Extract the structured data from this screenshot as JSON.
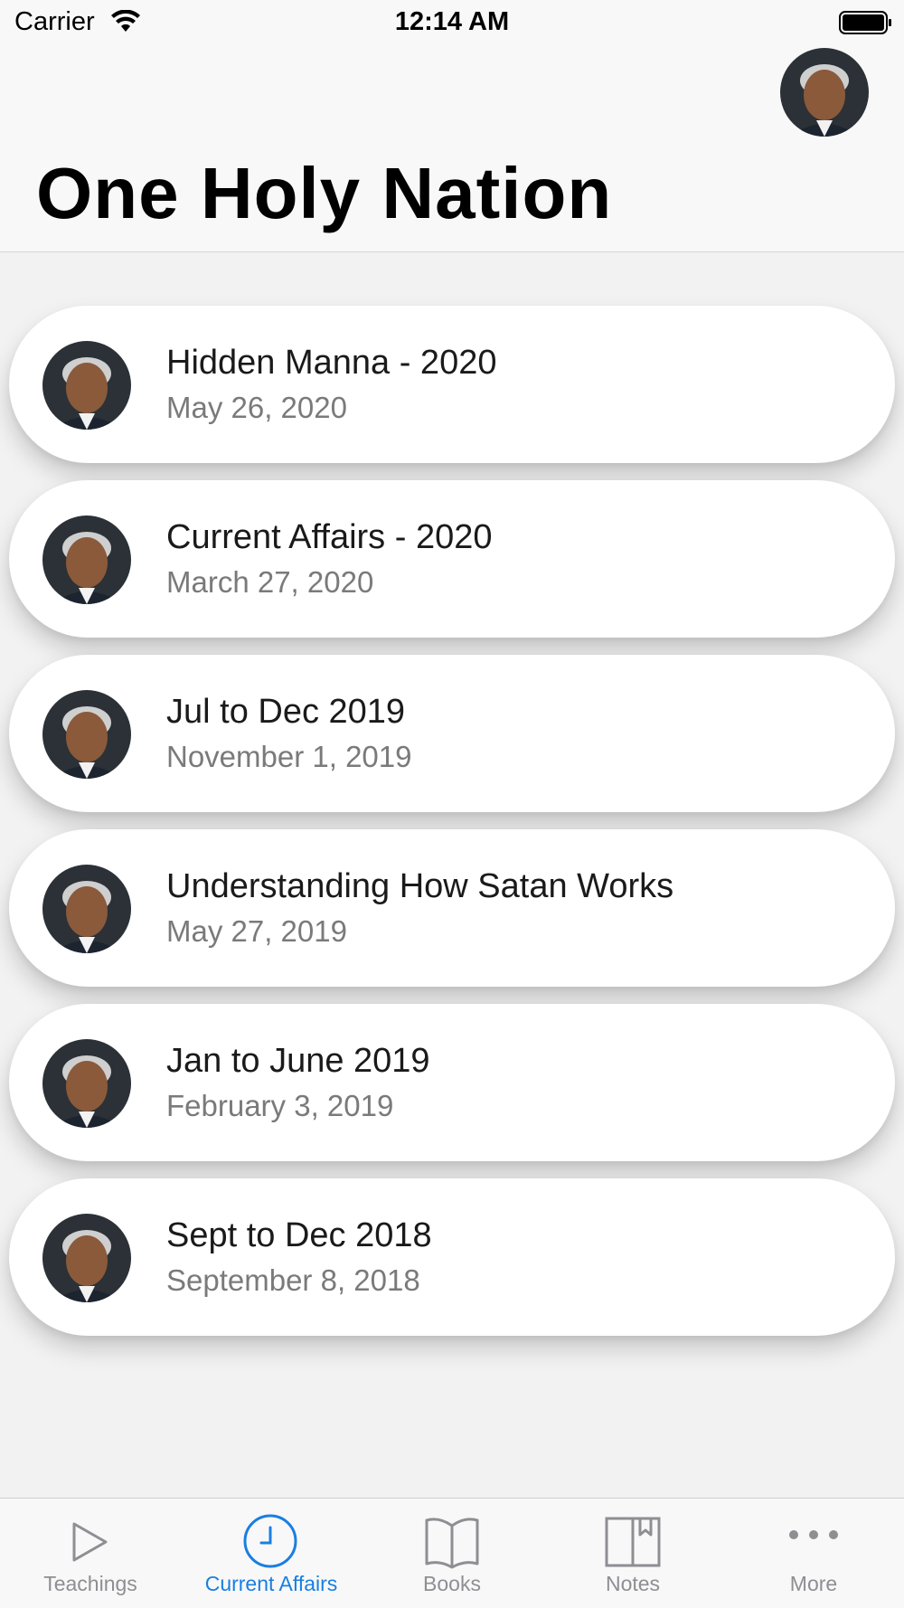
{
  "status_bar": {
    "carrier": "Carrier",
    "time": "12:14 AM"
  },
  "header": {
    "title": "One Holy Nation"
  },
  "items": [
    {
      "title": "Hidden Manna - 2020",
      "date": "May 26, 2020"
    },
    {
      "title": "Current Affairs - 2020",
      "date": "March 27, 2020"
    },
    {
      "title": "Jul to Dec 2019",
      "date": "November 1, 2019"
    },
    {
      "title": "Understanding How Satan Works",
      "date": "May 27, 2019"
    },
    {
      "title": "Jan to June 2019",
      "date": "February 3, 2019"
    },
    {
      "title": "Sept to Dec 2018",
      "date": "September 8, 2018"
    }
  ],
  "tabs": [
    {
      "label": "Teachings",
      "icon": "play-icon",
      "active": false
    },
    {
      "label": "Current Affairs",
      "icon": "clock-icon",
      "active": true
    },
    {
      "label": "Books",
      "icon": "book-icon",
      "active": false
    },
    {
      "label": "Notes",
      "icon": "notes-icon",
      "active": false
    },
    {
      "label": "More",
      "icon": "more-icon",
      "active": false
    }
  ],
  "colors": {
    "accent": "#1a7fe0",
    "inactive_tab": "#8e8e93",
    "subtitle": "#7a7a7a"
  }
}
